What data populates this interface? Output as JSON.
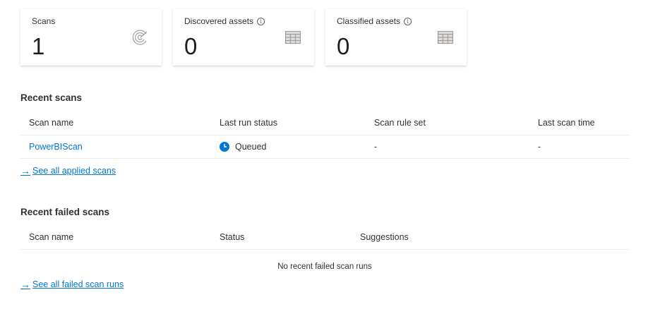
{
  "cards": [
    {
      "label": "Scans",
      "value": "1",
      "has_info": false,
      "icon": "scan-radar-icon"
    },
    {
      "label": "Discovered assets",
      "value": "0",
      "has_info": true,
      "icon": "table-grid-icon"
    },
    {
      "label": "Classified assets",
      "value": "0",
      "has_info": true,
      "icon": "table-grid-icon"
    }
  ],
  "recent_scans": {
    "title": "Recent scans",
    "columns": [
      "Scan name",
      "Last run status",
      "Scan rule set",
      "Last scan time"
    ],
    "rows": [
      {
        "scan_name": "PowerBIScan",
        "status": "Queued",
        "status_icon": "queued-clock-icon",
        "rule_set": "-",
        "last_scan_time": "-"
      }
    ],
    "see_all_label": "See all applied scans"
  },
  "recent_failed_scans": {
    "title": "Recent failed scans",
    "columns": [
      "Scan name",
      "Status",
      "Suggestions"
    ],
    "empty_message": "No recent failed scan runs",
    "see_all_label": "See all failed scan runs"
  },
  "colors": {
    "link": "#0078d4",
    "status_queued": "#0078d4",
    "divider": "#edebe9",
    "icon_gray": "#a19f9d"
  }
}
